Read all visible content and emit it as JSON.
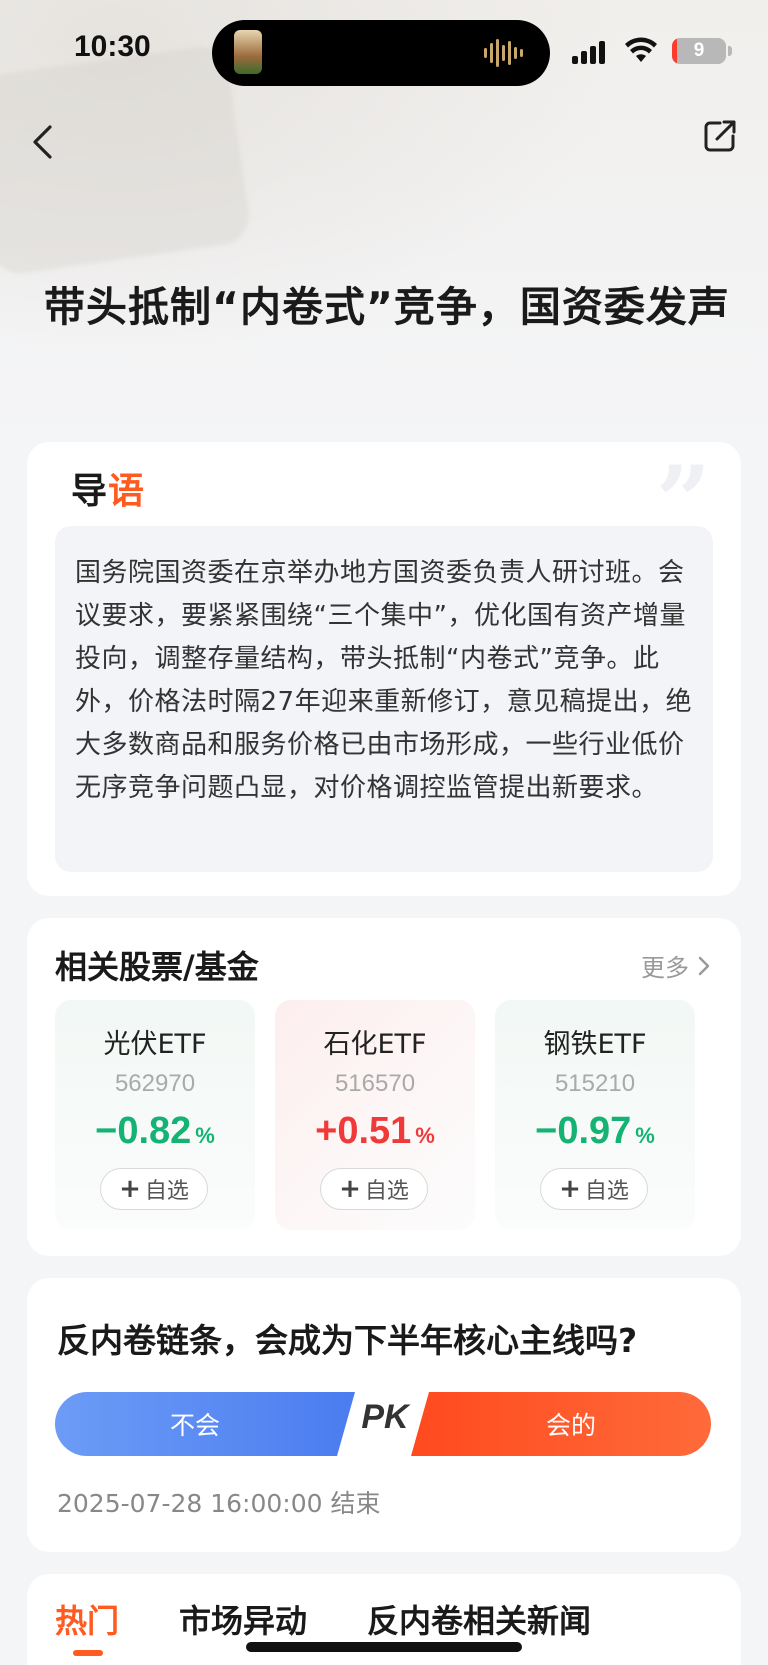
{
  "status_bar": {
    "time": "10:30",
    "battery": "9",
    "battery_level": 0.09
  },
  "article": {
    "title": "带头抵制“内卷式”竞争，国资委发声"
  },
  "intro": {
    "label_part1": "导",
    "label_part2": "语",
    "quote_mark": "”",
    "body": "国务院国资委在京举办地方国资委负责人研讨班。会议要求，要紧紧围绕“三个集中”，优化国有资产增量投向，调整存量结构，带头抵制“内卷式”竞争。此外，价格法时隔27年迎来重新修订，意见稿提出，绝大多数商品和服务价格已由市场形成，一些行业低价无序竞争问题凸显，对价格调控监管提出新要求。"
  },
  "related": {
    "title": "相关股票/基金",
    "more": "更多",
    "stocks": [
      {
        "name": "光伏ETF",
        "code": "562970",
        "change": "−0.82",
        "pct": "%",
        "add": "自选",
        "direction": "down"
      },
      {
        "name": "石化ETF",
        "code": "516570",
        "change": "+0.51",
        "pct": "%",
        "add": "自选",
        "direction": "up"
      },
      {
        "name": "钢铁ETF",
        "code": "515210",
        "change": "−0.97",
        "pct": "%",
        "add": "自选",
        "direction": "down"
      }
    ]
  },
  "pk": {
    "question": "反内卷链条，会成为下半年核心主线吗?",
    "left_option": "不会",
    "vs": "PK",
    "right_option": "会的",
    "deadline": "2025-07-28 16:00:00 结束",
    "colors": {
      "left": "#5b8cf3",
      "right": "#ff5226"
    }
  },
  "tabs": [
    {
      "label": "热门",
      "active": true
    },
    {
      "label": "市场异动",
      "active": false
    },
    {
      "label": "反内卷相关新闻",
      "active": false
    }
  ],
  "colors": {
    "accent": "#ff5a1f",
    "down": "#14b373",
    "up": "#f03a3a"
  },
  "icons": {
    "back": "chevron-left-icon",
    "share": "share-icon",
    "more": "chevron-right-icon",
    "add": "plus-icon"
  }
}
